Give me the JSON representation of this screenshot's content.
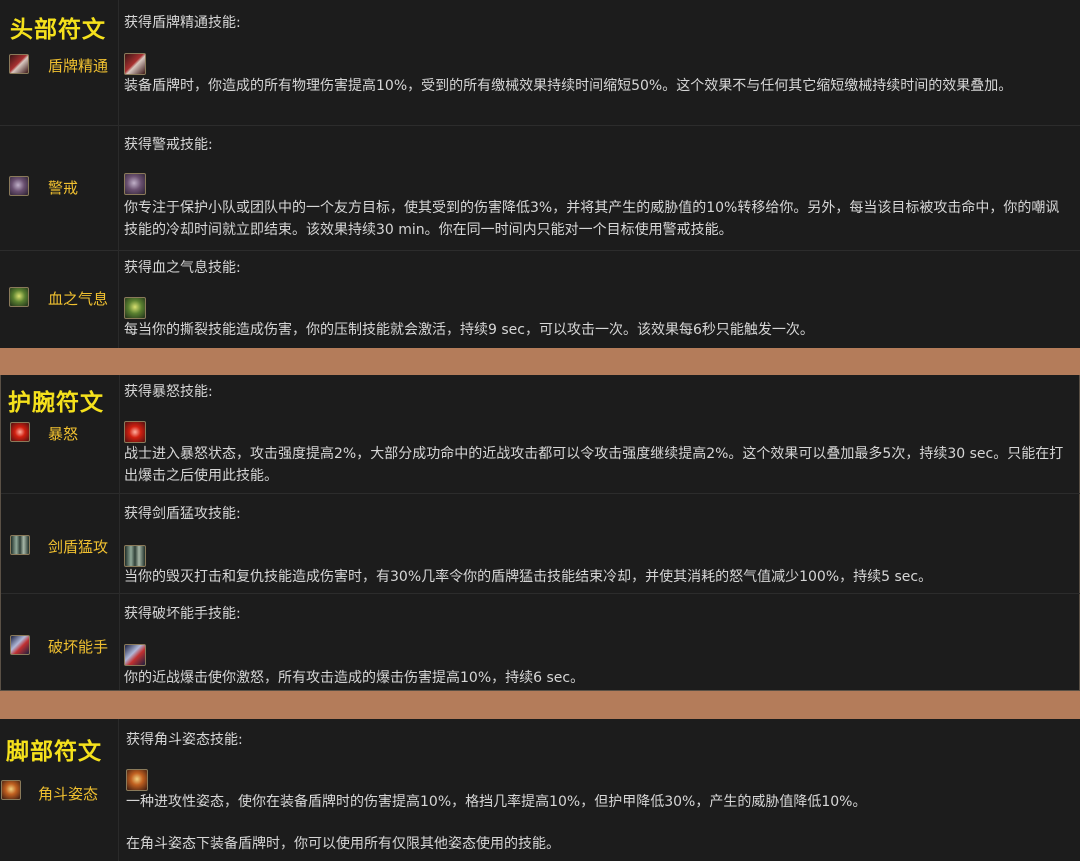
{
  "sections": [
    {
      "title": "头部符文",
      "runes": [
        {
          "name": "盾牌精通",
          "icon": "shield-mastery-icon",
          "grant": "获得盾牌精通技能:",
          "desc": "装备盾牌时，你造成的所有物理伤害提高10%，受到的所有缴械效果持续时间缩短50%。这个效果不与任何其它缩短缴械持续时间的效果叠加。"
        },
        {
          "name": "警戒",
          "icon": "vigilance-icon",
          "grant": "获得警戒技能:",
          "desc": "你专注于保护小队或团队中的一个友方目标，使其受到的伤害降低3%，并将其产生的威胁值的10%转移给你。另外，每当该目标被攻击命中，你的嘲讽技能的冷却时间就立即结束。该效果持续30 min。你在同一时间内只能对一个目标使用警戒技能。"
        },
        {
          "name": "血之气息",
          "icon": "blood-surge-icon",
          "grant": "获得血之气息技能:",
          "desc": "每当你的撕裂技能造成伤害，你的压制技能就会激活，持续9 sec，可以攻击一次。该效果每6秒只能触发一次。"
        }
      ]
    },
    {
      "title": "护腕符文",
      "runes": [
        {
          "name": "暴怒",
          "icon": "enrage-icon",
          "grant": "获得暴怒技能:",
          "desc": "战士进入暴怒状态，攻击强度提高2%，大部分成功命中的近战攻击都可以令攻击强度继续提高2%。这个效果可以叠加最多5次，持续30 sec。只能在打出爆击之后使用此技能。"
        },
        {
          "name": "剑盾猛攻",
          "icon": "sword-and-board-icon",
          "grant": "获得剑盾猛攻技能:",
          "desc": "当你的毁灭打击和复仇技能造成伤害时，有30%几率令你的盾牌猛击技能结束冷却，并使其消耗的怒气值减少100%，持续5 sec。"
        },
        {
          "name": "破坏能手",
          "icon": "wrecking-crew-icon",
          "grant": "获得破坏能手技能:",
          "desc": "你的近战爆击使你激怒，所有攻击造成的爆击伤害提高10%，持续6 sec。"
        }
      ]
    },
    {
      "title": "脚部符文",
      "runes": [
        {
          "name": "角斗姿态",
          "icon": "gladiator-stance-icon",
          "grant": "获得角斗姿态技能:",
          "desc": "一种进攻性姿态，使你在装备盾牌时的伤害提高10%，格挡几率提高10%，但护甲降低30%，产生的威胁值降低10%。",
          "desc2": "在角斗姿态下装备盾牌时，你可以使用所有仅限其他姿态使用的技能。"
        }
      ]
    }
  ],
  "colors": {
    "title": "#f5e11c",
    "rune_name": "#f0c030",
    "separator": "#b47c5a",
    "background": "#1c1c1c"
  }
}
